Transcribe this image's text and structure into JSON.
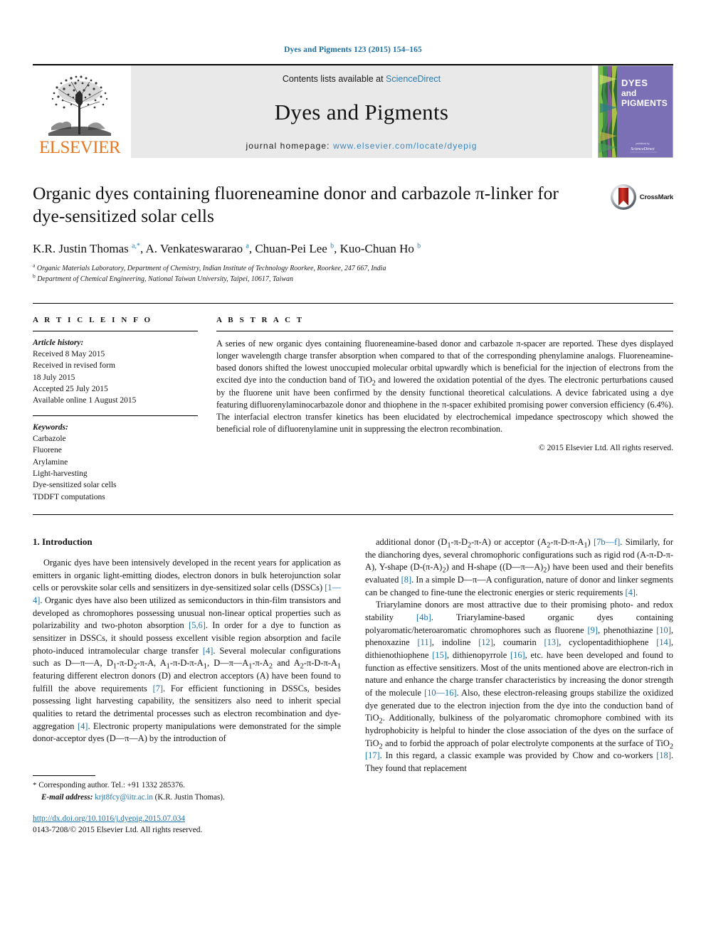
{
  "running_head": "Dyes and Pigments 123 (2015) 154–165",
  "masthead": {
    "publisher_name": "ELSEVIER",
    "contents_prefix": "Contents lists available at ",
    "contents_link": "ScienceDirect",
    "journal_name": "Dyes and Pigments",
    "homepage_prefix": "journal homepage: ",
    "homepage_url": "www.elsevier.com/locate/dyepig",
    "cover": {
      "line1": "DYES",
      "line2": "and",
      "line3": "PIGMENTS",
      "footer_top": "published by",
      "footer_main": "ScienceDirect",
      "bg_color": "#7b6fb5"
    }
  },
  "article": {
    "title": "Organic dyes containing fluoreneamine donor and carbazole π-linker for dye-sensitized solar cells",
    "crossmark_label": "CrossMark",
    "authors_html": "K.R. Justin Thomas <sup>a,</sup><sup>*</sup>, A. Venkateswararao <sup>a</sup>, Chuan-Pei Lee <sup>b</sup>, Kuo-Chuan Ho <sup>b</sup>",
    "affiliations": [
      "Organic Materials Laboratory, Department of Chemistry, Indian Institute of Technology Roorkee, Roorkee, 247 667, India",
      "Department of Chemical Engineering, National Taiwan University, Taipei, 10617, Taiwan"
    ],
    "affiliation_markers": [
      "a",
      "b"
    ]
  },
  "article_info": {
    "heading": "A R T I C L E   I N F O",
    "history_label": "Article history:",
    "history": [
      "Received 8 May 2015",
      "Received in revised form",
      "18 July 2015",
      "Accepted 25 July 2015",
      "Available online 1 August 2015"
    ],
    "keywords_label": "Keywords:",
    "keywords": [
      "Carbazole",
      "Fluorene",
      "Arylamine",
      "Light-harvesting",
      "Dye-sensitized solar cells",
      "TDDFT computations"
    ]
  },
  "abstract": {
    "heading": "A B S T R A C T",
    "text": "A series of new organic dyes containing fluoreneamine-based donor and carbazole π-spacer are reported. These dyes displayed longer wavelength charge transfer absorption when compared to that of the corresponding phenylamine analogs. Fluoreneamine-based donors shifted the lowest unoccupied molecular orbital upwardly which is beneficial for the injection of electrons from the excited dye into the conduction band of TiO2 and lowered the oxidation potential of the dyes. The electronic perturbations caused by the fluorene unit have been confirmed by the density functional theoretical calculations. A device fabricated using a dye featuring difluorenylaminocarbazole donor and thiophene in the π-spacer exhibited promising power conversion efficiency (6.4%). The interfacial electron transfer kinetics has been elucidated by electrochemical impedance spectroscopy which showed the beneficial role of difluorenylamine unit in suppressing the electron recombination.",
    "copyright": "© 2015 Elsevier Ltd. All rights reserved."
  },
  "body": {
    "section_title": "1. Introduction",
    "left_paragraph_1_html": "Organic dyes have been intensively developed in the recent years for application as emitters in organic light-emitting diodes, electron donors in bulk heterojunction solar cells or perovskite solar cells and sensitizers in dye-sensitized solar cells (DSSCs) <span class=\"ref\">[1&mdash;4]</span>. Organic dyes have also been utilized as semiconductors in thin-film transistors and developed as chromophores possessing unusual non-linear optical properties such as polarizability and two-photon absorption <span class=\"ref\">[5,6]</span>. In order for a dye to function as sensitizer in DSSCs, it should possess excellent visible region absorption and facile photo-induced intramolecular charge transfer <span class=\"ref\">[4]</span>. Several molecular configurations such as D&mdash;&pi;&mdash;A, D<sub>1</sub>-&pi;-D<sub>2</sub>-&pi;-A, A<sub>1</sub>-&pi;-D-&pi;-A<sub>1</sub>, D&mdash;&pi;&mdash;A<sub>1</sub>-&pi;-A<sub>2</sub> and A<sub>2</sub>-&pi;-D-&pi;-A<sub>1</sub> featuring different electron donors (D) and electron acceptors (A) have been found to fulfill the above requirements <span class=\"ref\">[7]</span>. For efficient functioning in DSSCs, besides possessing light harvesting capability, the sensitizers also need to inherit special qualities to retard the detrimental processes such as electron recombination and dye-aggregation <span class=\"ref\">[4]</span>. Electronic property manipulations were demonstrated for the simple donor-acceptor dyes (D&mdash;&pi;&mdash;A) by the introduction of",
    "right_paragraph_1_html": "additional donor (D<sub>1</sub>-&pi;-D<sub>2</sub>-&pi;-A) or acceptor (A<sub>2</sub>-&pi;-D-&pi;-A<sub>1</sub>) <span class=\"ref\">[7b&mdash;f]</span>. Similarly, for the dianchoring dyes, several chromophoric configurations such as rigid rod (A-&pi;-D-&pi;-A), Y-shape (D-(&pi;-A)<sub>2</sub>) and H-shape ((D&mdash;&pi;&mdash;A)<sub>2</sub>) have been used and their benefits evaluated <span class=\"ref\">[8]</span>. In a simple D&mdash;&pi;&mdash;A configuration, nature of donor and linker segments can be changed to fine-tune the electronic energies or steric requirements <span class=\"ref\">[4]</span>.",
    "right_paragraph_2_html": "Triarylamine donors are most attractive due to their promising photo- and redox stability <span class=\"ref\">[4b]</span>. Triarylamine-based organic dyes containing polyaromatic/heteroaromatic chromophores such as fluorene <span class=\"ref\">[9]</span>, phenothiazine <span class=\"ref\">[10]</span>, phenoxazine <span class=\"ref\">[11]</span>, indoline <span class=\"ref\">[12]</span>, coumarin <span class=\"ref\">[13]</span>, cyclopentadithiophene <span class=\"ref\">[14]</span>, dithienothiophene <span class=\"ref\">[15]</span>, dithienopyrrole <span class=\"ref\">[16]</span>, etc. have been developed and found to function as effective sensitizers. Most of the units mentioned above are electron-rich in nature and enhance the charge transfer characteristics by increasing the donor strength of the molecule <span class=\"ref\">[10&mdash;16]</span>. Also, these electron-releasing groups stabilize the oxidized dye generated due to the electron injection from the dye into the conduction band of TiO<sub>2</sub>. Additionally, bulkiness of the polyaromatic chromophore combined with its hydrophobicity is helpful to hinder the close association of the dyes on the surface of TiO<sub>2</sub> and to forbid the approach of polar electrolyte components at the surface of TiO<sub>2</sub> <span class=\"ref\">[17]</span>. In this regard, a classic example was provided by Chow and co-workers <span class=\"ref\">[18]</span>. They found that replacement"
  },
  "footer": {
    "corresponding_html": "<span class=\"star\">*</span> Corresponding author. Tel.: +91 1332 285376.",
    "email_label": "E-mail address:",
    "email": "krjt8fcy@iitr.ac.in",
    "email_suffix": "(K.R. Justin Thomas).",
    "doi": "http://dx.doi.org/10.1016/j.dyepig.2015.07.034",
    "issn": "0143-7208/© 2015 Elsevier Ltd. All rights reserved."
  },
  "colors": {
    "link": "#1a72a8",
    "elsevier_orange": "#e87722",
    "band_gray": "#e9e9e9"
  }
}
